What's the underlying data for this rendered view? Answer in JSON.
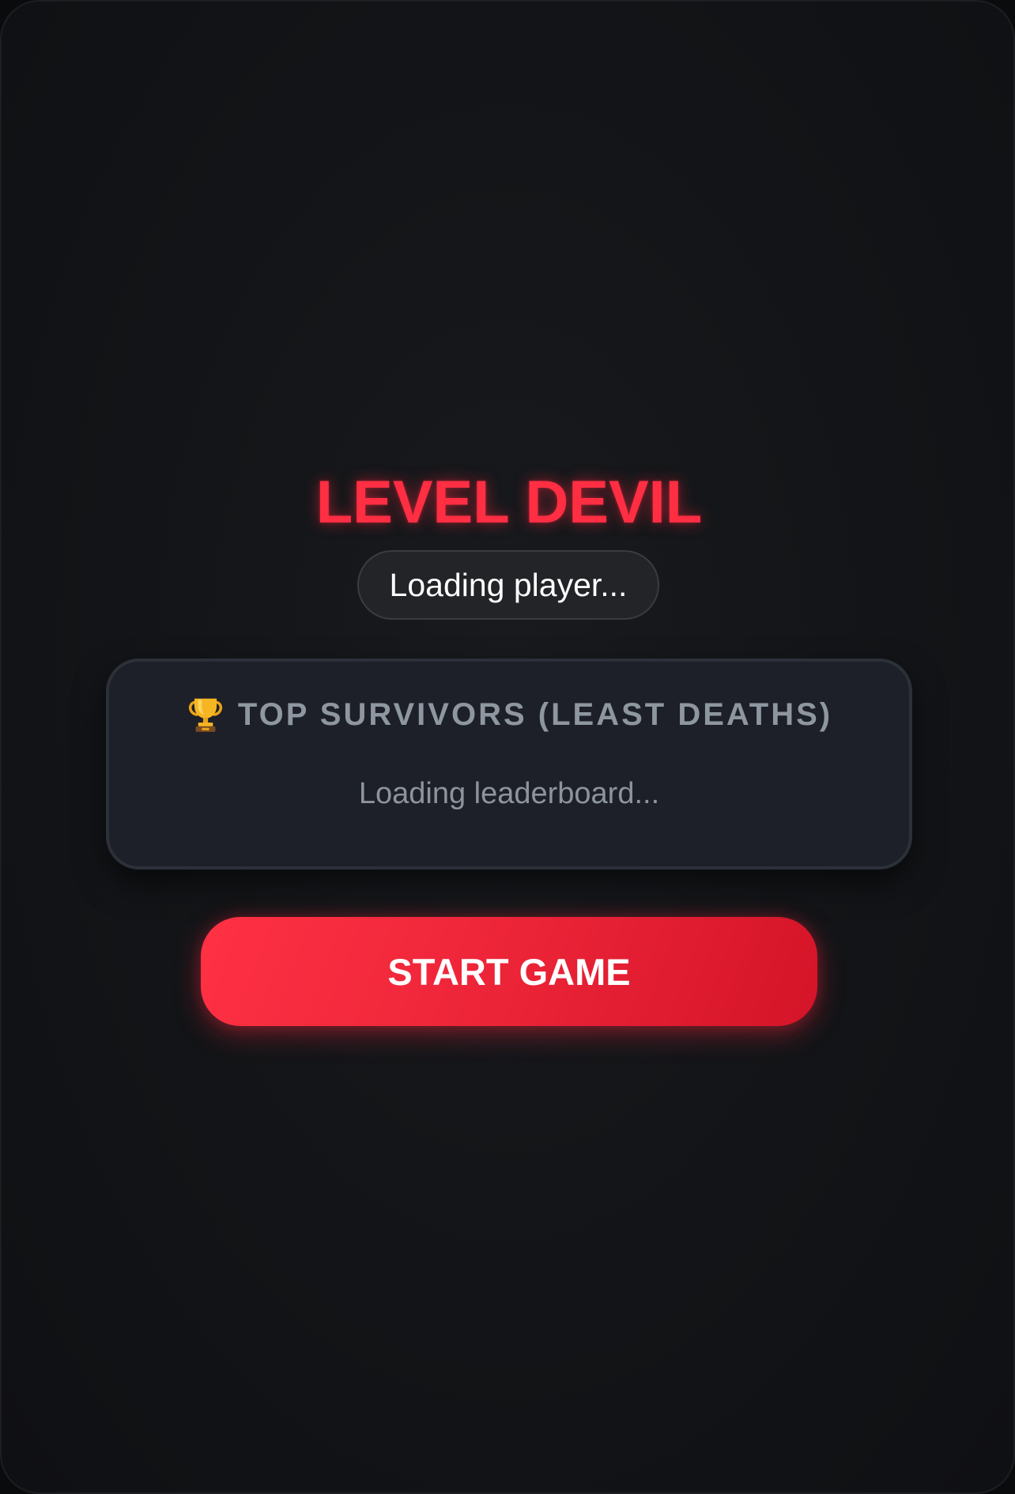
{
  "game": {
    "title": "LEVEL DEVIL",
    "player_status": "Loading player..."
  },
  "leaderboard": {
    "icon": "trophy-icon",
    "title": "TOP SURVIVORS (LEAST DEATHS)",
    "status": "Loading leaderboard..."
  },
  "actions": {
    "start_label": "START GAME"
  },
  "colors": {
    "accent": "#ff2e43",
    "background": "#131518",
    "panel": "#1d2028",
    "muted_text": "#8e969f"
  }
}
